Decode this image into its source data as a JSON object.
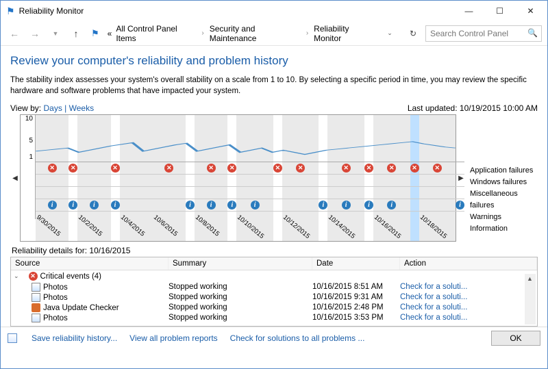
{
  "window": {
    "title": "Reliability Monitor"
  },
  "breadcrumbs": {
    "root_prefix": "«",
    "items": [
      "All Control Panel Items",
      "Security and Maintenance",
      "Reliability Monitor"
    ]
  },
  "search": {
    "placeholder": "Search Control Panel"
  },
  "heading": "Review your computer's reliability and problem history",
  "description": "The stability index assesses your system's overall stability on a scale from 1 to 10. By selecting a specific period in time, you may review the specific hardware and software problems that have impacted your system.",
  "viewby": {
    "label": "View by:",
    "days": "Days",
    "weeks": "Weeks"
  },
  "last_updated_label": "Last updated:",
  "last_updated_value": "10/19/2015 10:00 AM",
  "yaxis": {
    "top": "10",
    "mid": "5",
    "bot": "1"
  },
  "legend": {
    "app_failures": "Application failures",
    "win_failures": "Windows failures",
    "misc_failures": "Miscellaneous failures",
    "warnings": "Warnings",
    "information": "Information"
  },
  "chart_data": {
    "type": "line",
    "ylim": [
      1,
      10
    ],
    "categories": [
      "9/30/2015",
      "10/2/2015",
      "10/4/2015",
      "10/6/2015",
      "10/8/2015",
      "10/10/2015",
      "10/12/2015",
      "10/14/2015",
      "10/16/2015",
      "10/18/2015"
    ],
    "series": [
      {
        "name": "Stability index",
        "values_per_half_day": [
          3.2,
          3.4,
          3.6,
          3.8,
          3.0,
          3.4,
          3.8,
          4.2,
          4.5,
          4.8,
          3.2,
          3.6,
          4.0,
          4.4,
          4.7,
          3.2,
          3.6,
          4.0,
          4.4,
          3.0,
          3.4,
          3.8,
          3.0,
          3.4,
          3.0,
          2.6,
          3.0,
          3.4,
          3.6,
          3.8,
          4.0,
          4.2,
          4.4,
          4.6,
          4.8,
          5.0,
          4.6,
          4.3,
          4.0,
          3.8
        ]
      }
    ],
    "events": {
      "application_failures_at_cols": [
        0,
        1,
        3,
        6,
        8,
        9,
        11,
        12,
        14,
        15,
        16,
        17,
        18
      ],
      "information_at_cols": [
        0,
        1,
        2,
        3,
        7,
        8,
        9,
        10,
        13,
        14,
        15,
        16,
        19
      ]
    },
    "selected_col": 17
  },
  "dates": [
    "9/30/2015",
    "",
    "10/2/2015",
    "",
    "10/4/2015",
    "",
    "10/6/2015",
    "",
    "10/8/2015",
    "",
    "10/10/2015",
    "",
    "10/12/2015",
    "",
    "10/14/2015",
    "",
    "10/16/2015",
    "",
    "10/18/2015",
    ""
  ],
  "details_for_label": "Reliability details for:",
  "details_for_date": "10/16/2015",
  "grid": {
    "headers": {
      "source": "Source",
      "summary": "Summary",
      "date": "Date",
      "action": "Action"
    },
    "group_label": "Critical events (4)",
    "action_text": "Check for a soluti...",
    "rows": [
      {
        "source": "Photos",
        "icon": "app",
        "summary": "Stopped working",
        "date": "10/16/2015 8:51 AM"
      },
      {
        "source": "Photos",
        "icon": "app",
        "summary": "Stopped working",
        "date": "10/16/2015 9:31 AM"
      },
      {
        "source": "Java Update Checker",
        "icon": "java",
        "summary": "Stopped working",
        "date": "10/16/2015 2:48 PM"
      },
      {
        "source": "Photos",
        "icon": "app",
        "summary": "Stopped working",
        "date": "10/16/2015 3:53 PM"
      }
    ]
  },
  "footer": {
    "save": "Save reliability history...",
    "view_all": "View all problem reports",
    "check_all": "Check for solutions to all problems ...",
    "ok": "OK"
  }
}
